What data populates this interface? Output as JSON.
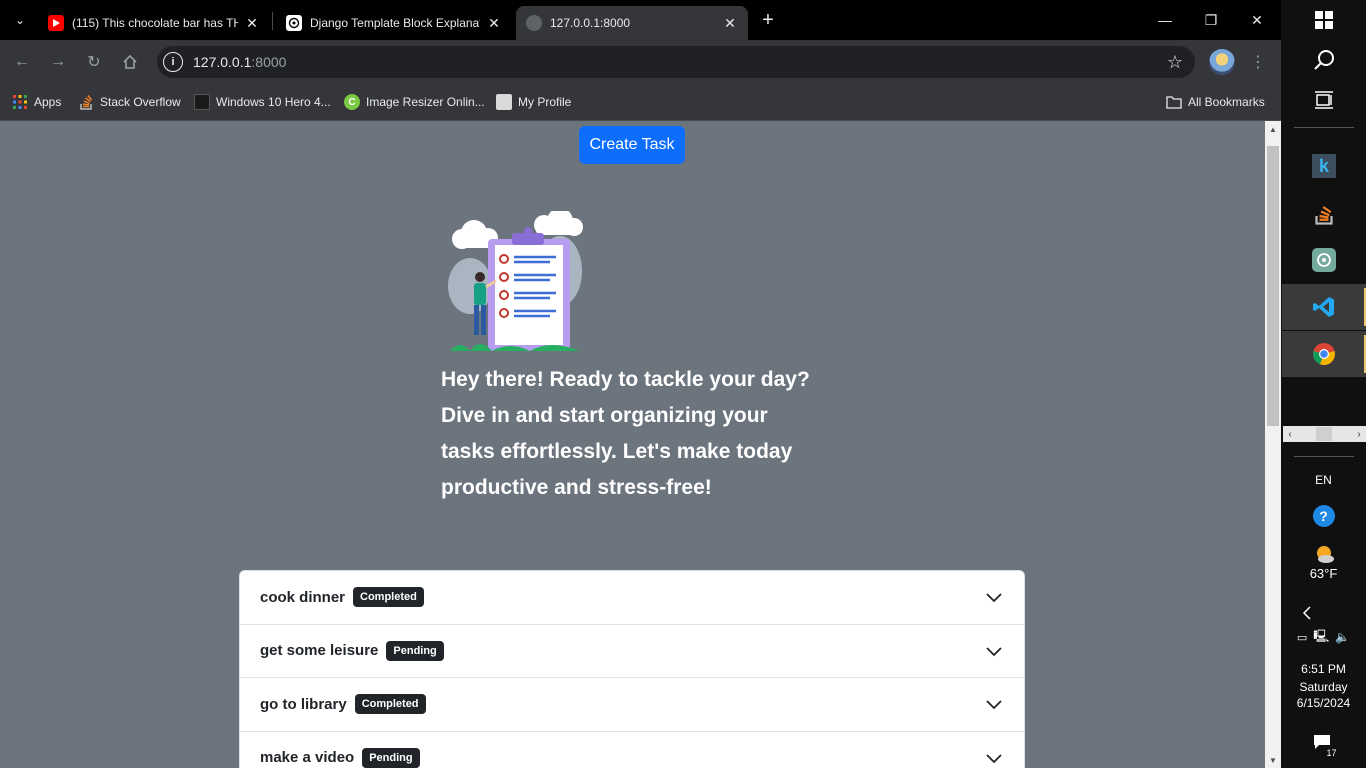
{
  "tabs": [
    {
      "title": "(115) This chocolate bar has THIS",
      "favicon": "youtube-icon"
    },
    {
      "title": "Django Template Block Explanation",
      "favicon": "chatgpt-icon"
    },
    {
      "title": "127.0.0.1:8000",
      "favicon": "globe-icon",
      "active": true
    }
  ],
  "address": {
    "host": "127.0.0.1",
    "port": ":8000"
  },
  "bookmarks": [
    {
      "label": "Apps",
      "icon": "apps-grid-icon"
    },
    {
      "label": "Stack Overflow",
      "icon": "stackoverflow-icon"
    },
    {
      "label": "Windows 10 Hero 4...",
      "icon": "windows-hero-icon"
    },
    {
      "label": "Image Resizer Onlin...",
      "icon": "image-resizer-icon"
    },
    {
      "label": "My Profile",
      "icon": "profile-page-icon"
    }
  ],
  "all_bookmarks": "All Bookmarks",
  "page": {
    "create_button": "Create Task",
    "hero_text": "Hey there! Ready to tackle your day? Dive in and start organizing your tasks effortlessly. Let's make today productive and stress-free!",
    "tasks": [
      {
        "name": "cook dinner",
        "status": "Completed"
      },
      {
        "name": "get some leisure",
        "status": "Pending"
      },
      {
        "name": "go to library",
        "status": "Completed"
      },
      {
        "name": "make a video",
        "status": "Pending"
      }
    ]
  },
  "taskbar": {
    "language": "EN",
    "temperature": "63°F",
    "time": "6:51 PM",
    "day": "Saturday",
    "date": "6/15/2024",
    "notifications": "17"
  },
  "colors": {
    "page_bg": "#6c757d",
    "primary": "#0d6efd",
    "badge_bg": "#212529"
  }
}
